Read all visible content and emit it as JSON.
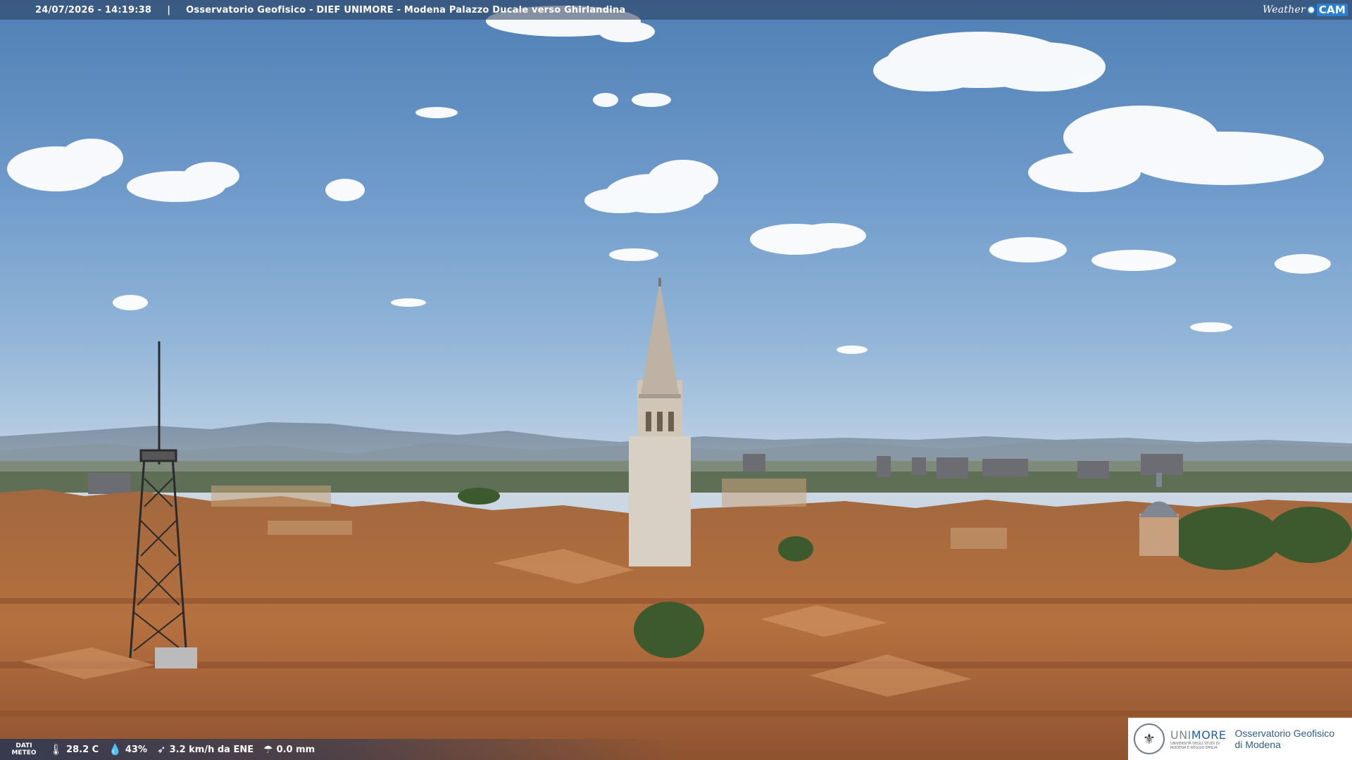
{
  "header": {
    "timestamp": "24/07/2026 - 14:19:38",
    "separator": "|",
    "title": "Osservatorio Geofisico - DIEF UNIMORE - Modena Palazzo Ducale verso Ghirlandina",
    "logo": {
      "weather": "Weather",
      "cam": "CAM"
    }
  },
  "weather": {
    "dati_label_1": "DATI",
    "dati_label_2": "METEO",
    "temperature": "28.2 C",
    "humidity": "43%",
    "wind": "3.2 km/h da ENE",
    "rain": "0.0 mm",
    "icons": [
      "thermometer-icon",
      "humidity-icon",
      "wind-icon",
      "rain-icon"
    ]
  },
  "branding": {
    "university": "UNIMORE",
    "university_prefix": "UNI",
    "university_suffix": "MORE",
    "university_sub_1": "UNIVERSITÀ DEGLI STUDI DI",
    "university_sub_2": "MODENA E REGGIO EMILIA",
    "observatory_line_1": "Osservatorio Geofisico",
    "observatory_line_2": "di Modena"
  },
  "colors": {
    "sky_top": "#4f7fb5",
    "roof": "#b9713f",
    "tower": "#d8d0c4",
    "accent_blue": "#1e5fa8"
  }
}
